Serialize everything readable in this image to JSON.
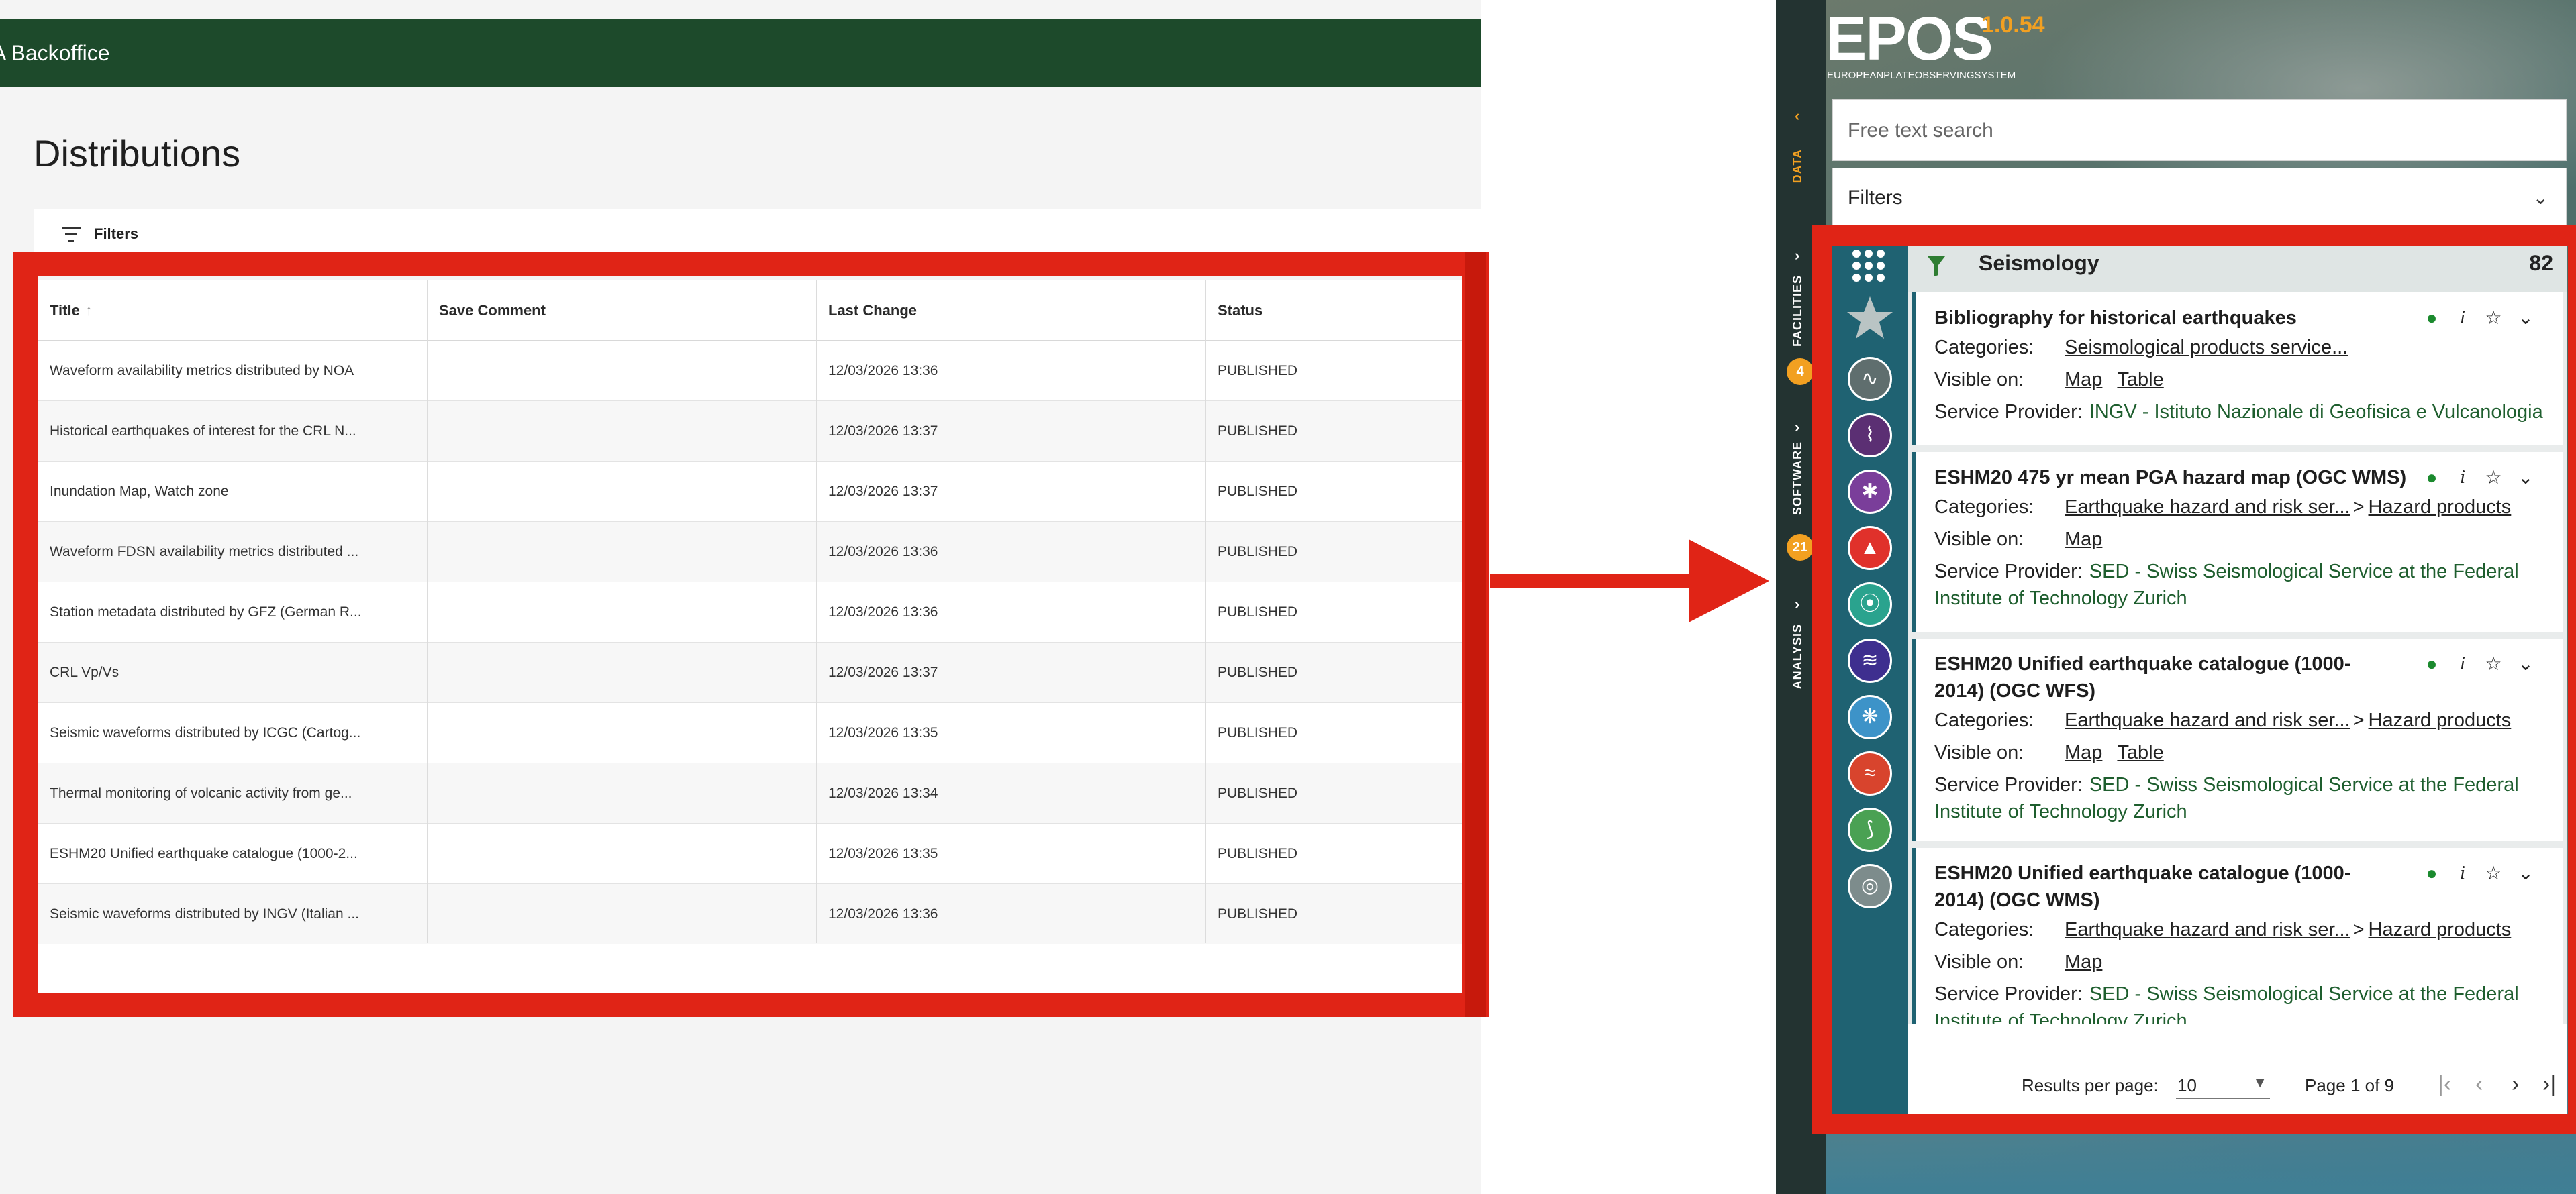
{
  "backoffice": {
    "header_title": "A Backoffice",
    "page_title": "Distributions",
    "filters_label": "Filters",
    "columns": [
      "Title",
      "Save Comment",
      "Last Change",
      "Status"
    ],
    "sort_indicator": "↑",
    "rows": [
      {
        "title": "Waveform availability metrics distributed by NOA",
        "comment": "",
        "last_change": "12/03/2026 13:36",
        "status": "PUBLISHED"
      },
      {
        "title": "Historical earthquakes of interest for the CRL N...",
        "comment": "",
        "last_change": "12/03/2026 13:37",
        "status": "PUBLISHED"
      },
      {
        "title": "Inundation Map, Watch zone",
        "comment": "",
        "last_change": "12/03/2026 13:37",
        "status": "PUBLISHED"
      },
      {
        "title": "Waveform FDSN availability metrics distributed ...",
        "comment": "",
        "last_change": "12/03/2026 13:36",
        "status": "PUBLISHED"
      },
      {
        "title": "Station metadata distributed by GFZ (German R...",
        "comment": "",
        "last_change": "12/03/2026 13:36",
        "status": "PUBLISHED"
      },
      {
        "title": "CRL Vp/Vs",
        "comment": "",
        "last_change": "12/03/2026 13:37",
        "status": "PUBLISHED"
      },
      {
        "title": "Seismic waveforms distributed by ICGC (Cartog...",
        "comment": "",
        "last_change": "12/03/2026 13:35",
        "status": "PUBLISHED"
      },
      {
        "title": "Thermal monitoring of volcanic activity from ge...",
        "comment": "",
        "last_change": "12/03/2026 13:34",
        "status": "PUBLISHED"
      },
      {
        "title": "ESHM20 Unified earthquake catalogue (1000-2...",
        "comment": "",
        "last_change": "12/03/2026 13:35",
        "status": "PUBLISHED"
      },
      {
        "title": "Seismic waveforms distributed by INGV (Italian ...",
        "comment": "",
        "last_change": "12/03/2026 13:36",
        "status": "PUBLISHED"
      }
    ]
  },
  "epos": {
    "logo_text": "EPOS",
    "logo_subtitle": "EUROPEANPLATEOBSERVINGSYSTEM",
    "version": "1.0.54",
    "side_tabs": {
      "data": "DATA",
      "facilities": "FACILITIES",
      "facilities_badge": "4",
      "software": "SOFTWARE",
      "software_badge": "21",
      "analysis": "ANALYSIS"
    },
    "search_placeholder": "Free text search",
    "filters_label": "Filters",
    "domain": {
      "title": "Seismology",
      "count": "82"
    },
    "labels": {
      "categories": "Categories:",
      "visible_on": "Visible on:",
      "service_provider": "Service Provider:"
    },
    "results": [
      {
        "title": "Bibliography for historical earthquakes",
        "categories": [
          "Seismological products service..."
        ],
        "visible_on": [
          "Map",
          "Table"
        ],
        "provider": "INGV - Istituto Nazionale di Geofisica e Vulcanologia",
        "provider_cont": ""
      },
      {
        "title": "ESHM20 475 yr mean PGA hazard map (OGC WMS)",
        "categories": [
          "Earthquake hazard and risk ser...",
          "Hazard products"
        ],
        "visible_on": [
          "Map"
        ],
        "provider": "SED - Swiss Seismological Service at the Federal",
        "provider_cont": "Institute of Technology Zurich"
      },
      {
        "title": "ESHM20 Unified earthquake catalogue (1000-",
        "title_cont": "2014) (OGC WFS)",
        "categories": [
          "Earthquake hazard and risk ser...",
          "Hazard products"
        ],
        "visible_on": [
          "Map",
          "Table"
        ],
        "provider": "SED - Swiss Seismological Service at the Federal",
        "provider_cont": "Institute of Technology Zurich"
      },
      {
        "title": "ESHM20 Unified earthquake catalogue (1000-",
        "title_cont": "2014) (OGC WMS)",
        "categories": [
          "Earthquake hazard and risk ser...",
          "Hazard products"
        ],
        "visible_on": [
          "Map"
        ],
        "provider": "SED - Swiss Seismological Service at the Federal",
        "provider_cont": "Institute of Technology Zurich"
      }
    ],
    "pager": {
      "label": "Results per page:",
      "per_page": "10",
      "page_text": "Page 1 of 9"
    },
    "colors": {
      "accent": "#f2a021",
      "header_green": "#1d4a2b",
      "highlight_red": "#e02416",
      "domain_teal": "#1f6272",
      "provider_green": "#1e5e2e"
    },
    "category_icons": [
      "seismology-icon",
      "near-fault-observatories-icon",
      "gnss-icon",
      "volcano-icon",
      "anthropogenic-hazards-icon",
      "geomagnetism-icon",
      "satellite-data-icon",
      "tsunami-icon",
      "geological-information-icon",
      "multi-scale-laboratories-icon"
    ]
  }
}
